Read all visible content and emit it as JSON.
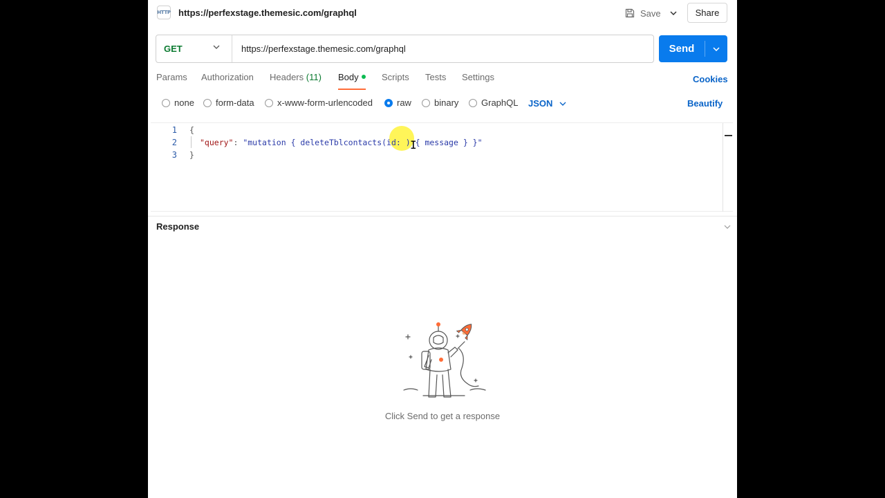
{
  "header": {
    "icon_text": "HTTP",
    "title": "https://perfexstage.themesic.com/graphql",
    "save_label": "Save",
    "share_label": "Share"
  },
  "request": {
    "method": "GET",
    "url": "https://perfexstage.themesic.com/graphql",
    "send_label": "Send"
  },
  "tabs": [
    {
      "label": "Params"
    },
    {
      "label": "Authorization"
    },
    {
      "label": "Headers",
      "count": "(11)"
    },
    {
      "label": "Body",
      "active": true
    },
    {
      "label": "Scripts"
    },
    {
      "label": "Tests"
    },
    {
      "label": "Settings"
    }
  ],
  "cookies_label": "Cookies",
  "body_options": [
    {
      "label": "none",
      "selected": false
    },
    {
      "label": "form-data",
      "selected": false
    },
    {
      "label": "x-www-form-urlencoded",
      "selected": false
    },
    {
      "label": "raw",
      "selected": true
    },
    {
      "label": "binary",
      "selected": false
    },
    {
      "label": "GraphQL",
      "selected": false
    }
  ],
  "raw_language": "JSON",
  "beautify_label": "Beautify",
  "editor": {
    "line_numbers": [
      "1",
      "2",
      "3"
    ],
    "line1": "{",
    "line2_key": "\"query\"",
    "line2_colon": ": ",
    "line2_value": "\"mutation { deleteTblcontacts(id: ) { message } }\"",
    "line3": "}"
  },
  "response": {
    "title": "Response",
    "empty_message": "Click Send to get a response"
  },
  "colors": {
    "accent": "#097bed",
    "method_get": "#0b7a30",
    "active_tab_underline": "#ff6c37",
    "link": "#0a64c8"
  }
}
